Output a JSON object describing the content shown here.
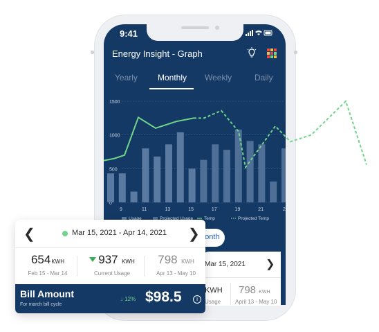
{
  "status_bar": {
    "time": "9:41"
  },
  "header": {
    "title": "Energy Insight - Graph",
    "icons": [
      "lightbulb-icon",
      "grid-icon"
    ]
  },
  "tabs": [
    {
      "label": "Yearly",
      "active": false
    },
    {
      "label": "Monthly",
      "active": true
    },
    {
      "label": "Weekly",
      "active": false
    },
    {
      "label": "Daily",
      "active": false
    }
  ],
  "chart_data": {
    "type": "bar",
    "y_ticks": [
      "1500",
      "1000",
      "500",
      "0"
    ],
    "ylim": [
      0,
      1500
    ],
    "x_tick_labels": [
      "9",
      "11",
      "13",
      "15",
      "17",
      "19",
      "21",
      "2"
    ],
    "legend": [
      "Usage",
      "Projected Usage",
      "Temp",
      "Projected Temp"
    ],
    "bars": [
      {
        "value": 430,
        "projected": false
      },
      {
        "value": 430,
        "projected": false
      },
      {
        "value": 160,
        "projected": false
      },
      {
        "value": 800,
        "projected": false
      },
      {
        "value": 680,
        "projected": false
      },
      {
        "value": 860,
        "projected": false
      },
      {
        "value": 1040,
        "projected": false
      },
      {
        "value": 500,
        "projected": false
      },
      {
        "value": 630,
        "projected": true
      },
      {
        "value": 860,
        "projected": true
      },
      {
        "value": 780,
        "projected": true
      },
      {
        "value": 1080,
        "projected": true
      },
      {
        "value": 910,
        "projected": true
      },
      {
        "value": 860,
        "projected": true
      },
      {
        "value": 310,
        "projected": true
      },
      {
        "value": 800,
        "projected": true
      }
    ],
    "temp_line": [
      650,
      700,
      1260,
      1100,
      1200,
      1250
    ],
    "projected_temp_line": [
      1250,
      1360,
      1050,
      520,
      800,
      1130,
      900,
      1000,
      1500,
      560
    ]
  },
  "date_range_button": {
    "label": "Month"
  },
  "background_card": {
    "date": "Mar 15, 2021",
    "frag_value": "KWH",
    "frag_sub": "Usage",
    "value": "798",
    "unit": "KWH",
    "range": "April 13 - May 10"
  },
  "bill_card": {
    "period": "Mar 15, 2021 - Apr 14, 2021",
    "stats": [
      {
        "value": "654",
        "unit": "KWH",
        "sub": "Feb 15 - Mar 14"
      },
      {
        "value": "937",
        "unit": "KWH",
        "sub": "Current Usage"
      },
      {
        "value": "798",
        "unit": "KWH",
        "sub": "Apr 13 - May 10"
      }
    ],
    "bill_title": "Bill Amount",
    "bill_subtitle": "For march bill cycle",
    "trend": "12%",
    "amount": "$98.5",
    "colors": {
      "navy": "#143964",
      "green": "#6fd68a"
    }
  }
}
